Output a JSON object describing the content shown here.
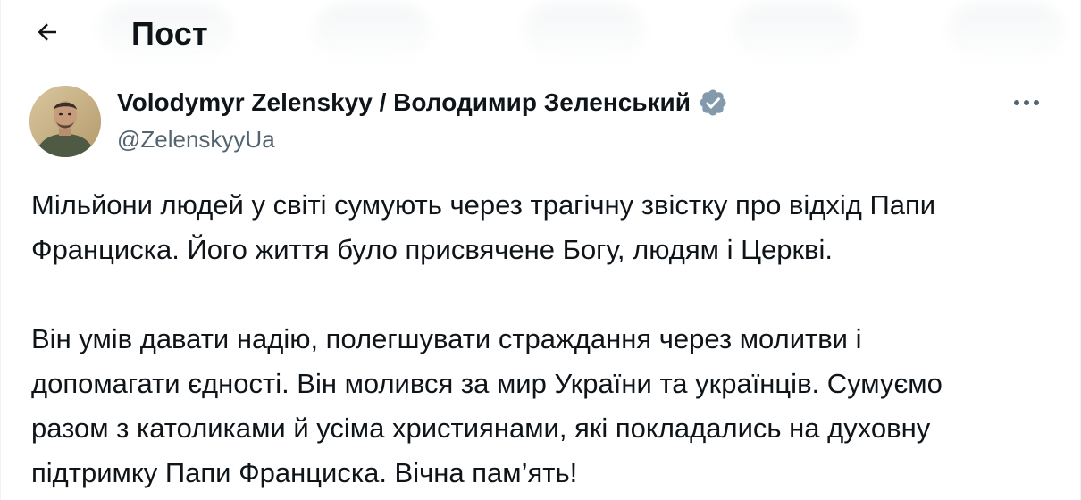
{
  "header": {
    "back_icon": "arrow-left-icon",
    "title": "Пост"
  },
  "author": {
    "display_name": "Volodymyr Zelenskyy / Володимир Зеленський",
    "handle": "@ZelenskyyUa",
    "verified_icon": "verified-badge-icon",
    "verified_color": "#829aab",
    "more_icon": "more-horizontal-icon"
  },
  "post": {
    "paragraphs": [
      [
        "Мільйони людей у світі сумують через трагічну звістку про відхід Папи",
        "Франциска. Його життя було присвячене Богу, людям і Церкві."
      ],
      [
        "Він умів давати надію, полегшувати страждання через молитви і",
        "допомагати єдності. Він молився за мир України та українців. Сумуємо",
        "разом з католиками й усіма християнами, які покладались на духовну",
        "підтримку Папи Франциска. Вічна пам’ять!"
      ]
    ]
  },
  "colors": {
    "text_primary": "#0f1419",
    "text_secondary": "#536471",
    "border": "#eff3f4"
  }
}
